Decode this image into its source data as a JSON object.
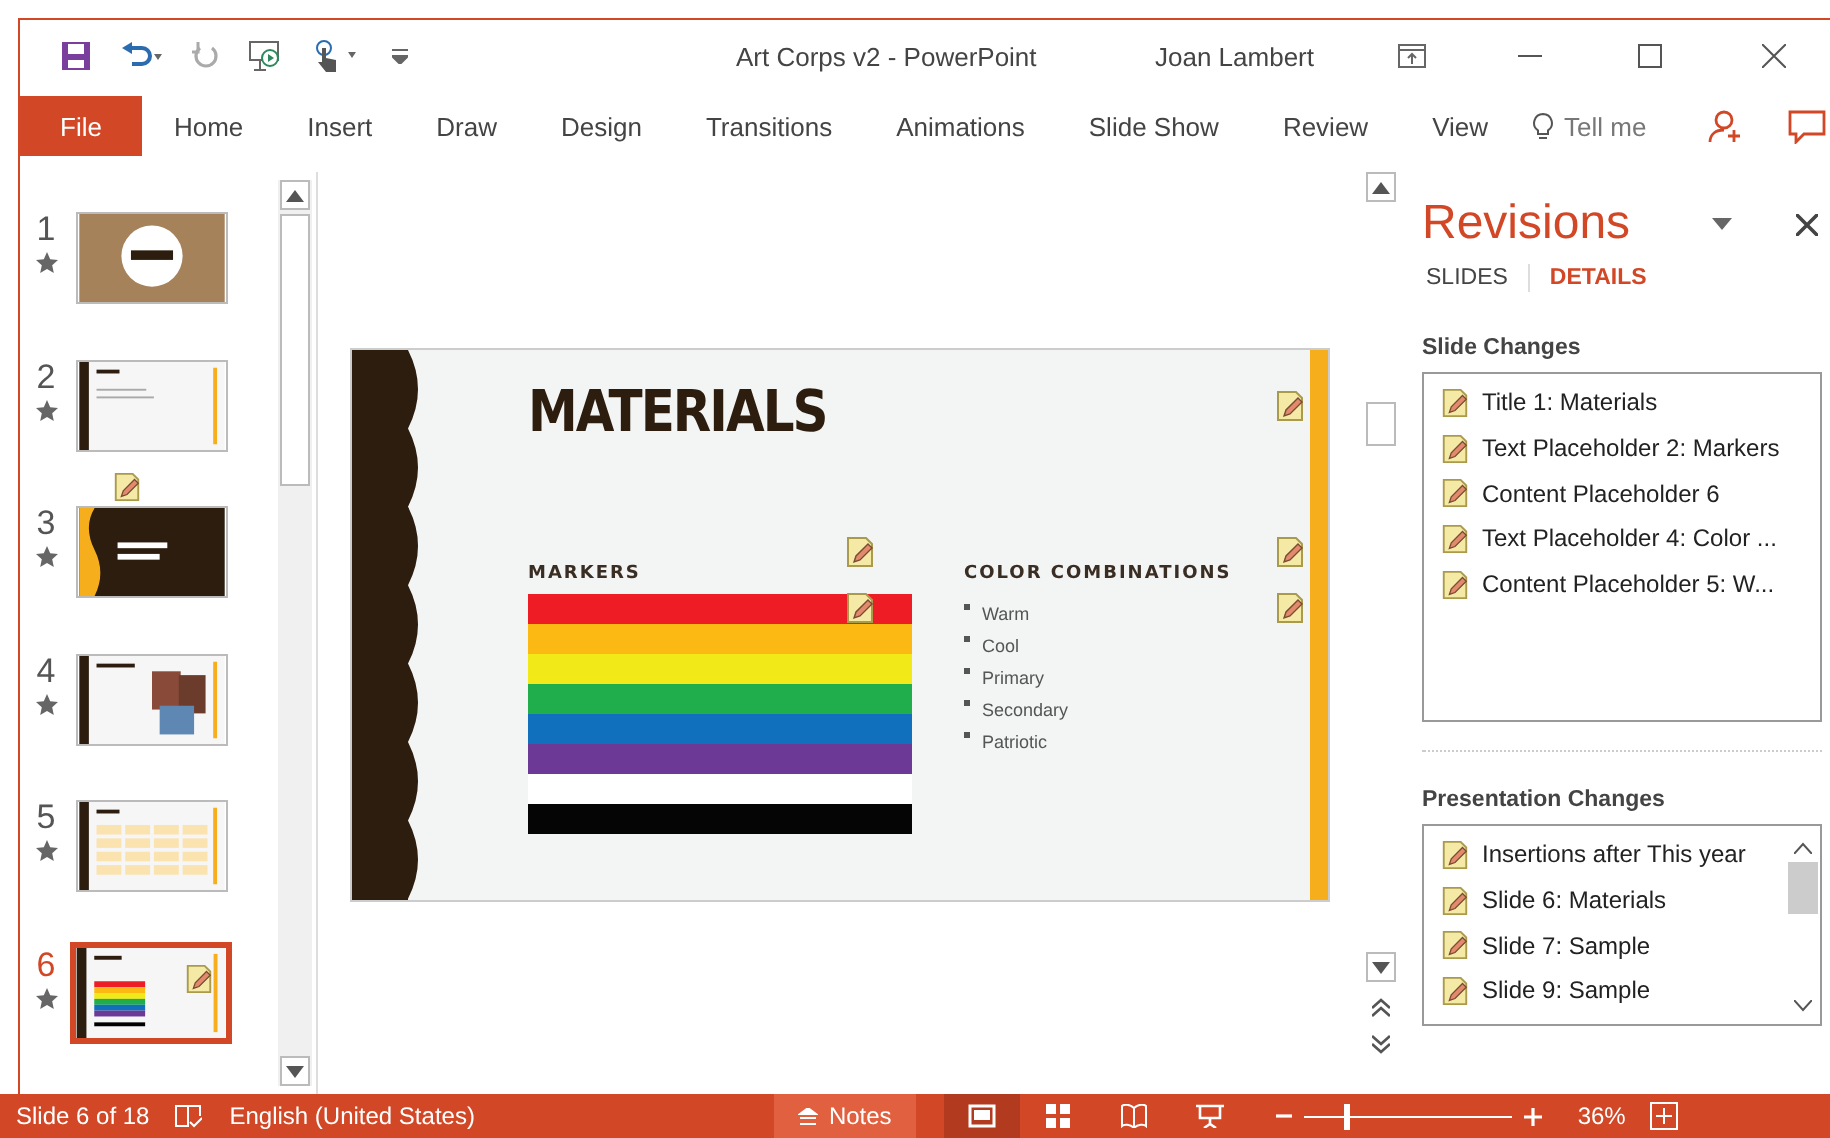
{
  "window": {
    "title": "Art Corps v2 - PowerPoint",
    "user": "Joan Lambert"
  },
  "ribbon": {
    "tabs": [
      {
        "label": "File",
        "kind": "file",
        "selected": false
      },
      {
        "label": "Home",
        "kind": "tab",
        "selected": false
      },
      {
        "label": "Insert",
        "kind": "tab",
        "selected": false
      },
      {
        "label": "Draw",
        "kind": "tab",
        "selected": false
      },
      {
        "label": "Design",
        "kind": "tab",
        "selected": false
      },
      {
        "label": "Transitions",
        "kind": "tab",
        "selected": false
      },
      {
        "label": "Animations",
        "kind": "tab",
        "selected": false
      },
      {
        "label": "Slide Show",
        "kind": "tab",
        "selected": false
      },
      {
        "label": "Review",
        "kind": "tab",
        "selected": false
      },
      {
        "label": "View",
        "kind": "tab",
        "selected": false
      }
    ],
    "tell_me": {
      "placeholder": "Tell me"
    }
  },
  "thumbnails": [
    {
      "number": "1",
      "kind": "title",
      "selected": false,
      "revised_after": false,
      "revised": false
    },
    {
      "number": "2",
      "kind": "bullets",
      "selected": false,
      "revised_after": true,
      "revised": false
    },
    {
      "number": "3",
      "kind": "section",
      "selected": false,
      "revised_after": false,
      "revised": false
    },
    {
      "number": "4",
      "kind": "pictures",
      "selected": false,
      "revised_after": false,
      "revised": false
    },
    {
      "number": "5",
      "kind": "table",
      "selected": false,
      "revised_after": false,
      "revised": false
    },
    {
      "number": "6",
      "kind": "materials",
      "selected": true,
      "revised_after": false,
      "revised": true
    }
  ],
  "slide": {
    "title": "MATERIALS",
    "left_heading": "MARKERS",
    "markers": [
      {
        "color": "#ee1c25"
      },
      {
        "color": "#fdb913"
      },
      {
        "color": "#f2e918"
      },
      {
        "color": "#1fae4b"
      },
      {
        "color": "#1170bd"
      },
      {
        "color": "#6d3996"
      },
      {
        "color": "#ffffff"
      },
      {
        "color": "#050505"
      }
    ],
    "right_heading": "COLOR COMBINATIONS",
    "bullets": [
      "Warm",
      "Cool",
      "Primary",
      "Secondary",
      "Patriotic"
    ]
  },
  "revisions": {
    "title": "Revisions",
    "tabs": [
      {
        "label": "SLIDES",
        "selected": false
      },
      {
        "label": "DETAILS",
        "selected": true
      }
    ],
    "slide_changes": {
      "heading": "Slide Changes",
      "items": [
        "Title 1: Materials",
        "Text Placeholder 2: Markers",
        "Content Placeholder 6",
        "Text Placeholder 4: Color ...",
        "Content Placeholder 5: W..."
      ]
    },
    "presentation_changes": {
      "heading": "Presentation Changes",
      "items": [
        "Insertions after This year",
        "Slide 6: Materials",
        "Slide 7: Sample",
        "Slide 9: Sample"
      ]
    }
  },
  "status_bar": {
    "slide": "Slide 6 of 18",
    "language": "English (United States)",
    "notes": "Notes",
    "views": [
      {
        "kind": "normal",
        "selected": true
      },
      {
        "kind": "sorter",
        "selected": false
      },
      {
        "kind": "reading",
        "selected": false
      },
      {
        "kind": "slideshow",
        "selected": false
      }
    ],
    "zoom": {
      "level": 0.2,
      "reading": "36%"
    }
  }
}
